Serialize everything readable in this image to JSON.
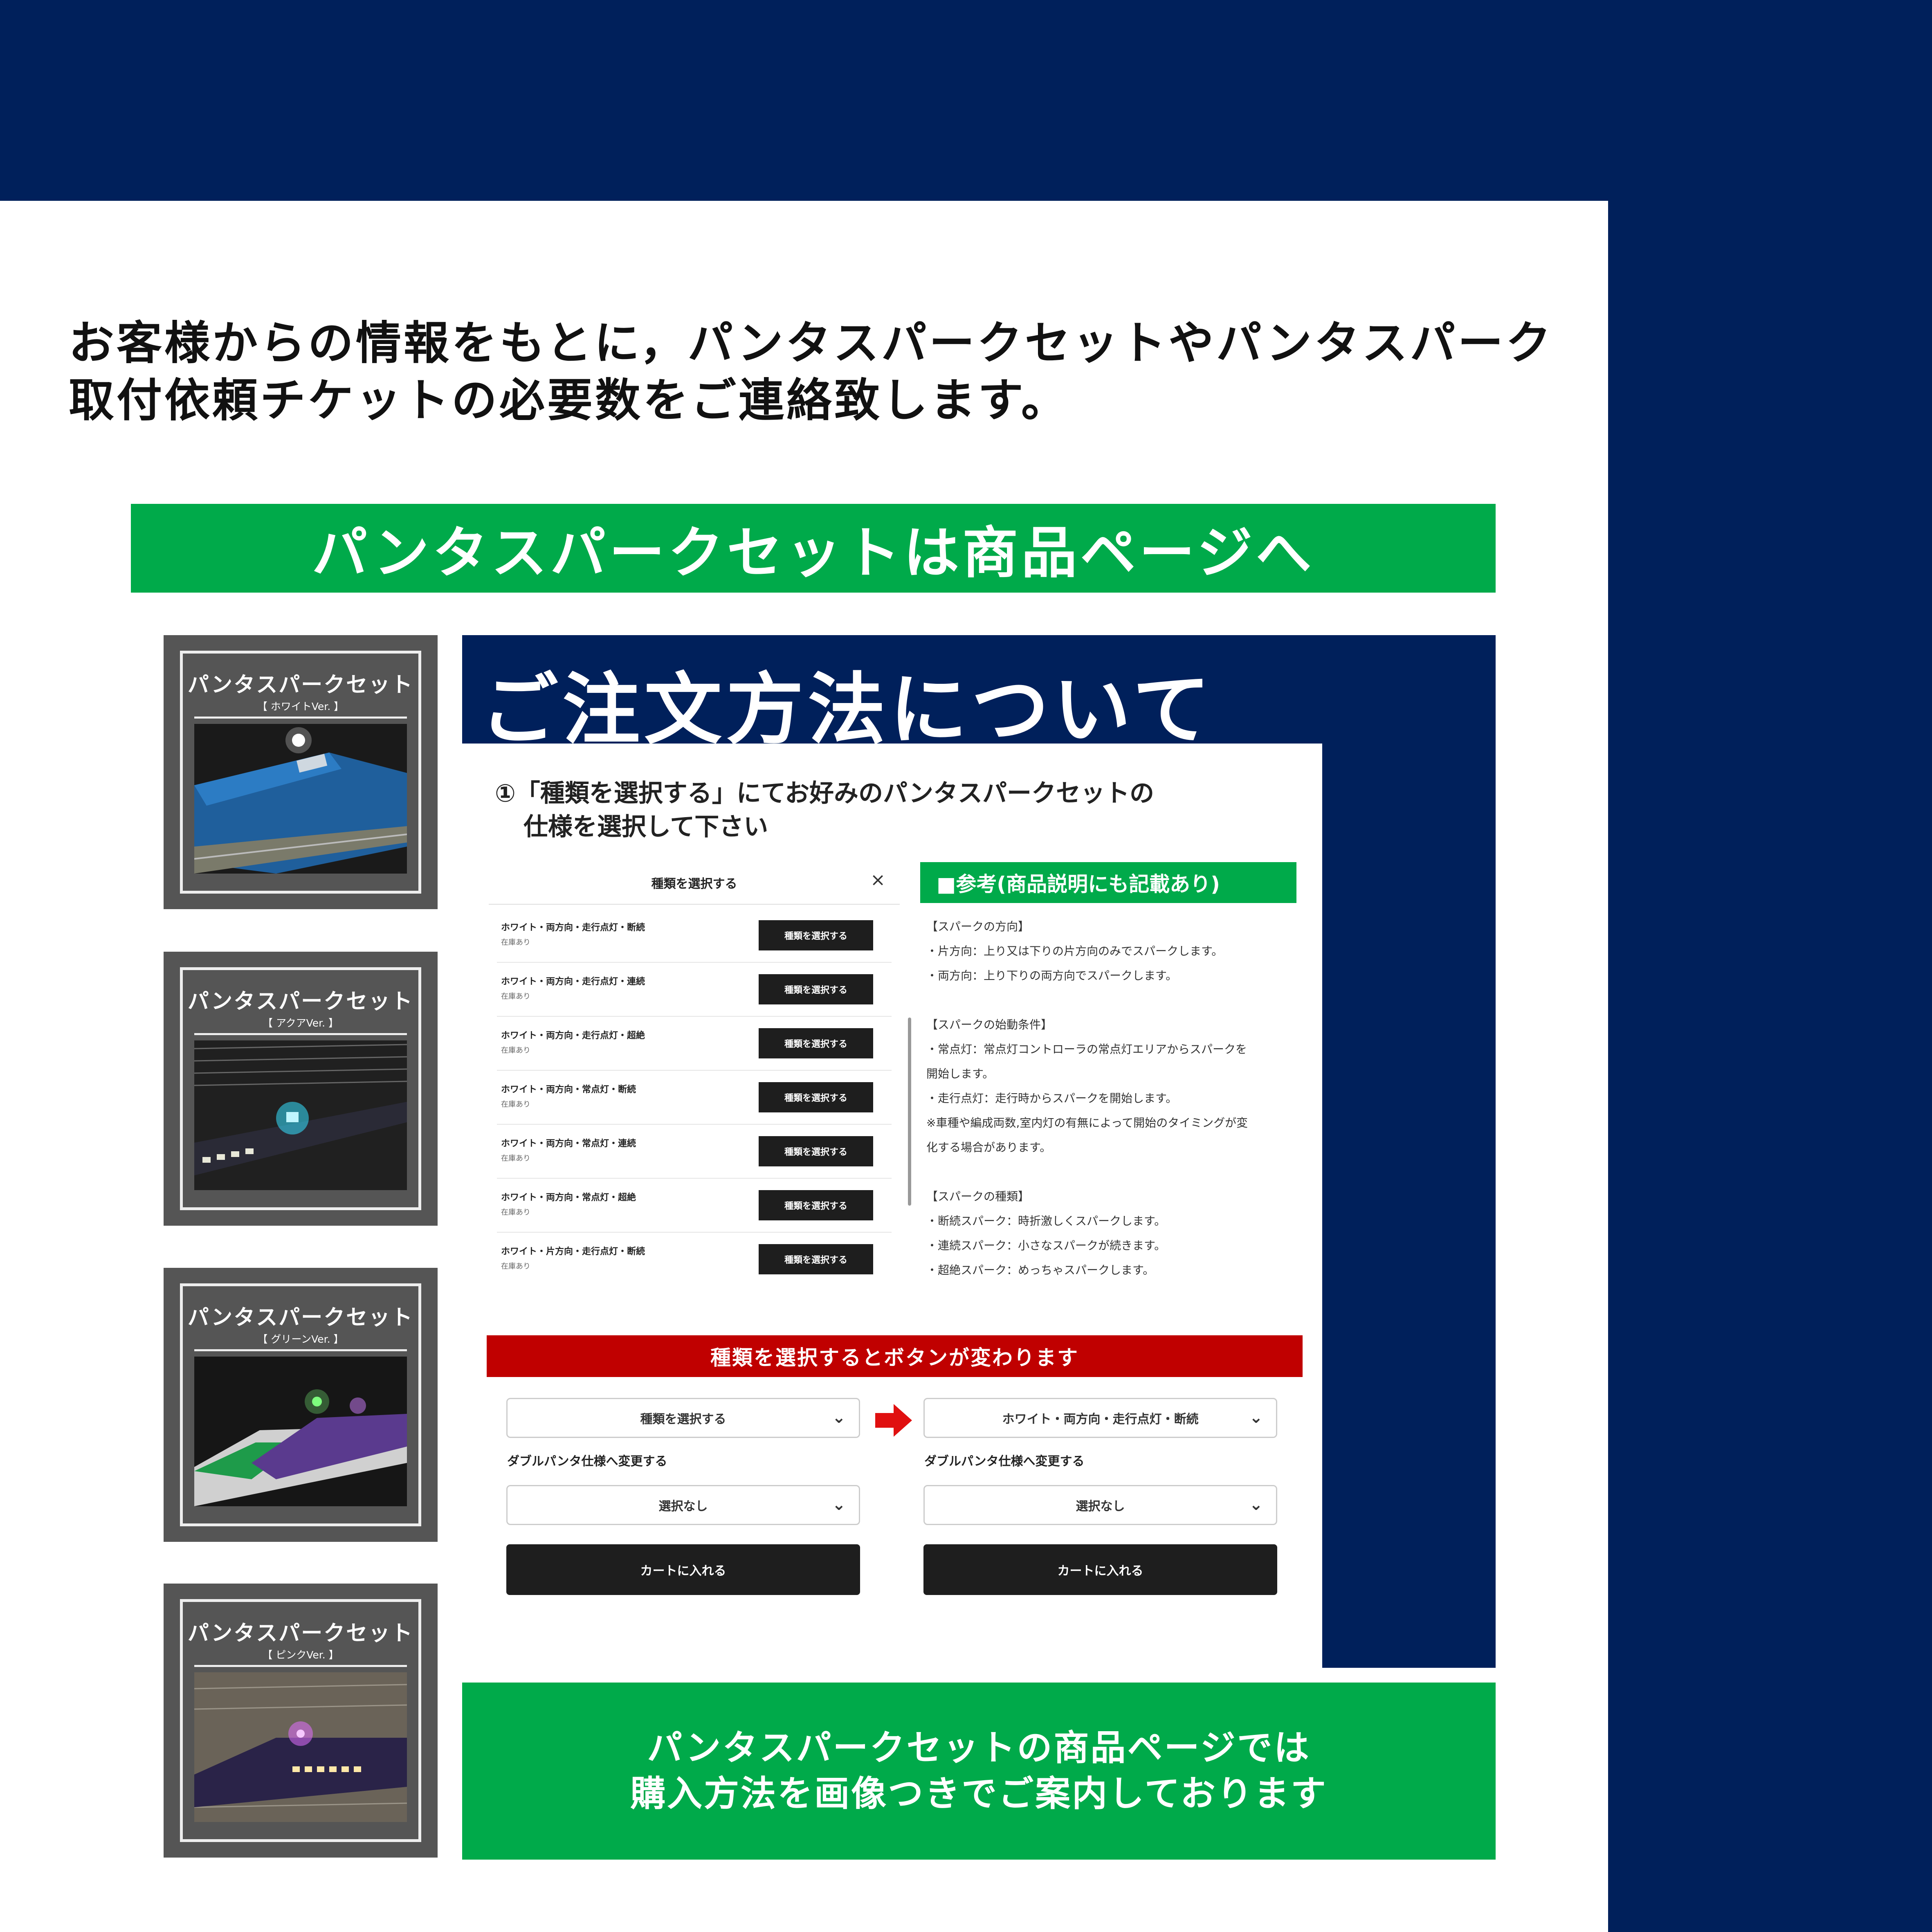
{
  "colors": {
    "navy": "#00205b",
    "green": "#00aa4a",
    "red": "#c00000",
    "dark_button": "#1e1e1e"
  },
  "intro": {
    "line1": "お客様からの情報をもとに，パンタスパークセットやパンタスパーク",
    "line2": "取付依頼チケットの必要数をご連絡致します。"
  },
  "header_link": "パンタスパークセットは商品ページへ",
  "products": [
    {
      "title": "パンタスパークセット",
      "subtitle": "【 ホワイトVer. 】"
    },
    {
      "title": "パンタスパークセット",
      "subtitle": "【 アクアVer. 】"
    },
    {
      "title": "パンタスパークセット",
      "subtitle": "【 グリーンVer. 】"
    },
    {
      "title": "パンタスパークセット",
      "subtitle": "【 ピンクVer. 】"
    }
  ],
  "order": {
    "title": "ご注文方法について",
    "step_line1": "①「種類を選択する」にてお好みのパンタスパークセットの",
    "step_line2": "仕様を選択して下さい",
    "select_title": "種類を選択する",
    "close_icon": "×",
    "options": [
      {
        "name": "ホワイト・両方向・走行点灯・断続",
        "stock": "在庫あり",
        "button": "種類を選択する"
      },
      {
        "name": "ホワイト・両方向・走行点灯・連続",
        "stock": "在庫あり",
        "button": "種類を選択する"
      },
      {
        "name": "ホワイト・両方向・走行点灯・超絶",
        "stock": "在庫あり",
        "button": "種類を選択する"
      },
      {
        "name": "ホワイト・両方向・常点灯・断続",
        "stock": "在庫あり",
        "button": "種類を選択する"
      },
      {
        "name": "ホワイト・両方向・常点灯・連続",
        "stock": "在庫あり",
        "button": "種類を選択する"
      },
      {
        "name": "ホワイト・両方向・常点灯・超絶",
        "stock": "在庫あり",
        "button": "種類を選択する"
      },
      {
        "name": "ホワイト・片方向・走行点灯・断続",
        "stock": "在庫あり",
        "button": "種類を選択する"
      }
    ],
    "reference_title": "■参考(商品説明にも記載あり)",
    "reference_lines": [
      "【スパークの方向】",
      "・片方向：上り又は下りの片方向のみでスパークします。",
      "・両方向：上り下りの両方向でスパークします。",
      "",
      "【スパークの始動条件】",
      "・常点灯：常点灯コントローラの常点灯エリアからスパークを",
      "開始します。",
      "・走行点灯：走行時からスパークを開始します。",
      "※車種や編成両数,室内灯の有無によって開始のタイミングが変",
      "化する場合があります。",
      "",
      "【スパークの種類】",
      "・断続スパーク：時折激しくスパークします。",
      "・連続スパーク：小さなスパークが続きます。",
      "・超絶スパーク：めっちゃスパークします。"
    ],
    "red_banner": "種類を選択するとボタンが変わります",
    "before": {
      "select": "種類を選択する",
      "double_label": "ダブルパンタ仕様へ変更する",
      "double_value": "選択なし",
      "cart": "カートに入れる"
    },
    "after": {
      "select": "ホワイト・両方向・走行点灯・断続",
      "double_label": "ダブルパンタ仕様へ変更する",
      "double_value": "選択なし",
      "cart": "カートに入れる"
    }
  },
  "bottom_note": {
    "line1": "パンタスパークセットの商品ページでは",
    "line2": "購入方法を画像つきでご案内しております"
  }
}
